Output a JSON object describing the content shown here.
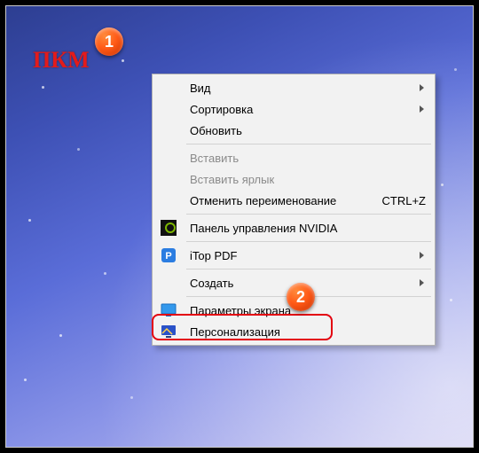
{
  "annotation": {
    "pkm_label": "ПКМ",
    "badge1": "1",
    "badge2": "2"
  },
  "menu": {
    "view": "Вид",
    "sort": "Сортировка",
    "refresh": "Обновить",
    "paste": "Вставить",
    "paste_shortcut": "Вставить ярлык",
    "undo_rename": "Отменить переименование",
    "undo_shortcut": "CTRL+Z",
    "nvidia": "Панель управления NVIDIA",
    "itop": "iTop PDF",
    "new": "Создать",
    "display": "Параметры экрана",
    "personalize": "Персонализация"
  },
  "icons": {
    "nvidia": "nvidia-icon",
    "itop": "itop-pdf-icon",
    "display": "display-icon",
    "personalize": "personalize-icon"
  }
}
